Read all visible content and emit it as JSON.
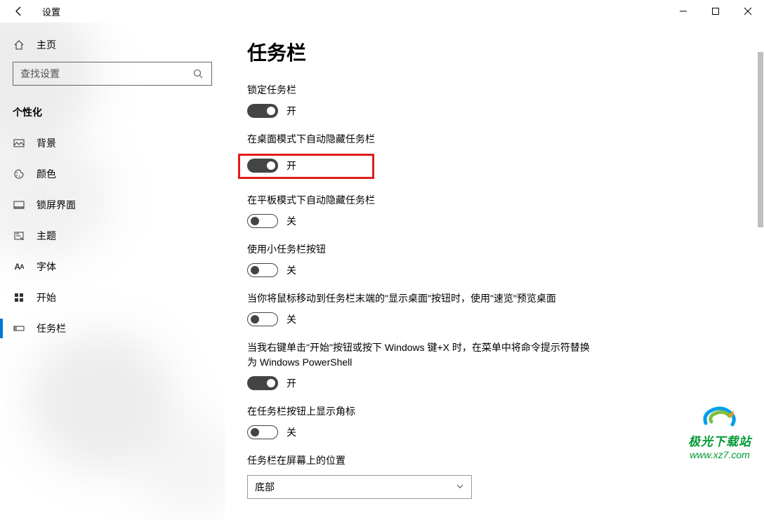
{
  "titlebar": {
    "app_title": "设置"
  },
  "sidebar": {
    "home_label": "主页",
    "search_placeholder": "查找设置",
    "category": "个性化",
    "items": [
      {
        "label": "背景"
      },
      {
        "label": "颜色"
      },
      {
        "label": "锁屏界面"
      },
      {
        "label": "主题"
      },
      {
        "label": "字体"
      },
      {
        "label": "开始"
      },
      {
        "label": "任务栏"
      }
    ]
  },
  "content": {
    "title": "任务栏",
    "settings": [
      {
        "label": "锁定任务栏",
        "on": true,
        "state": "开"
      },
      {
        "label": "在桌面模式下自动隐藏任务栏",
        "on": true,
        "state": "开",
        "highlighted": true
      },
      {
        "label": "在平板模式下自动隐藏任务栏",
        "on": false,
        "state": "关"
      },
      {
        "label": "使用小任务栏按钮",
        "on": false,
        "state": "关"
      },
      {
        "label": "当你将鼠标移动到任务栏末端的\"显示桌面\"按钮时，使用\"速览\"预览桌面",
        "on": false,
        "state": "关"
      },
      {
        "label": "当我右键单击\"开始\"按钮或按下 Windows 键+X 时，在菜单中将命令提示符替换为 Windows PowerShell",
        "on": true,
        "state": "开"
      },
      {
        "label": "在任务栏按钮上显示角标",
        "on": false,
        "state": "关"
      }
    ],
    "position_label": "任务栏在屏幕上的位置",
    "position_value": "底部"
  },
  "watermark": {
    "brand": "极光下载站",
    "url": "www.xz7.com"
  }
}
